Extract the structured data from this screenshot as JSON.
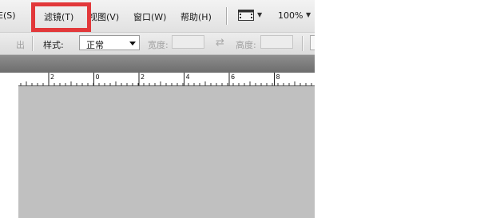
{
  "menubar": {
    "items": [
      {
        "label": "E(S)"
      },
      {
        "label": "滤镜(T)"
      },
      {
        "label": "视图(V)"
      },
      {
        "label": "窗口(W)"
      },
      {
        "label": "帮助(H)"
      }
    ],
    "zoom": "100%"
  },
  "options": {
    "feather_partial": "出",
    "style_label": "样式:",
    "style_value": "正常",
    "width_label": "宽度:",
    "height_label": "高度:"
  },
  "ruler": {
    "labels": [
      "2",
      "0",
      "2",
      "4",
      "6",
      "8"
    ]
  },
  "colors": {
    "highlight": "#e2383a",
    "canvas": "#c0c0c0"
  }
}
